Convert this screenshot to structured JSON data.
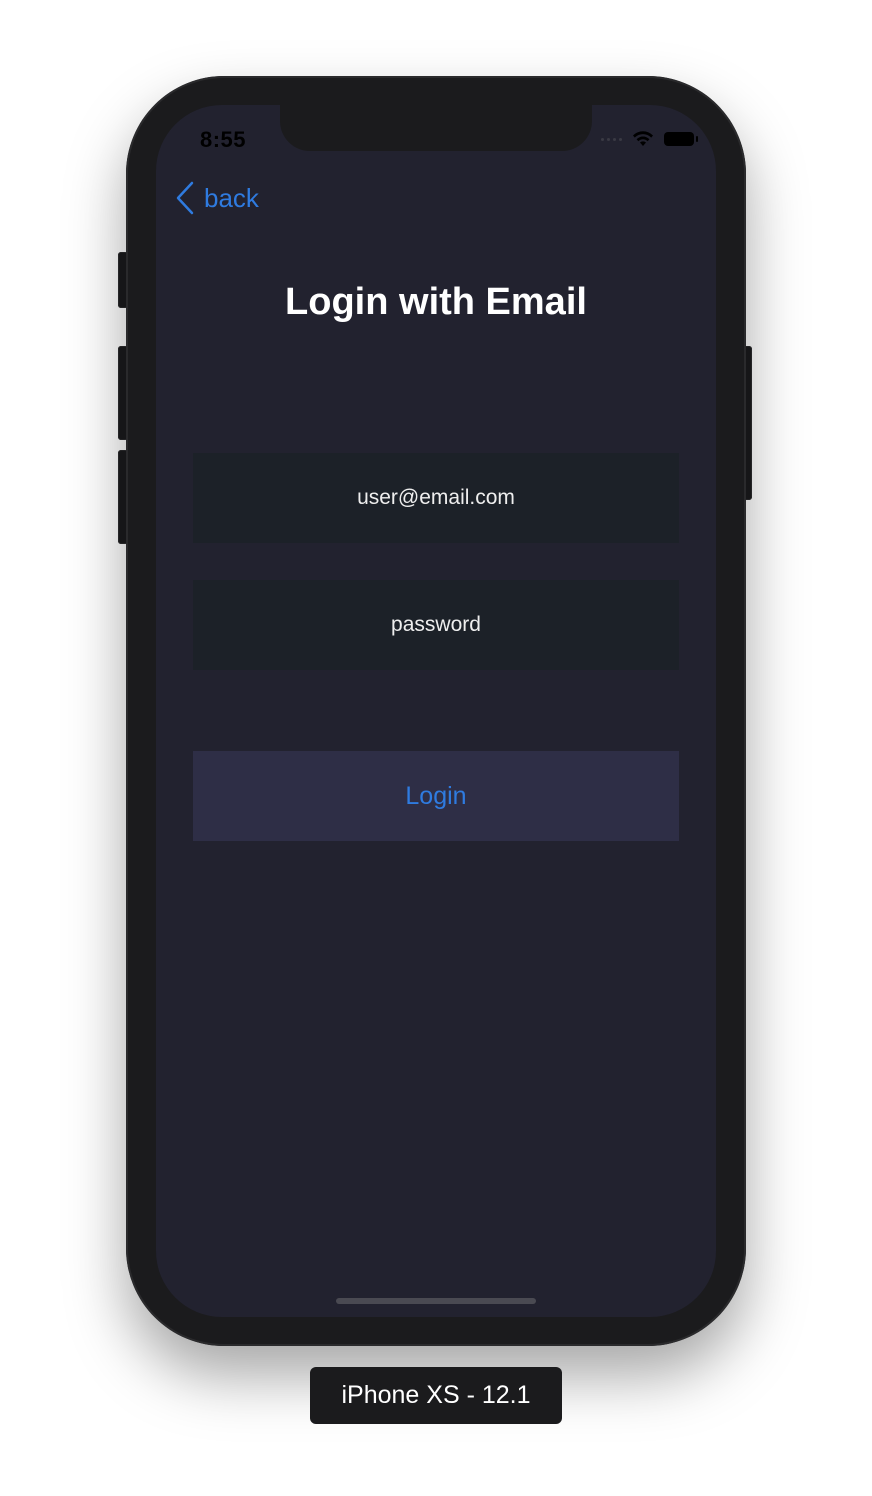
{
  "status_bar": {
    "time": "8:55"
  },
  "nav": {
    "back_label": "back"
  },
  "main": {
    "title": "Login with Email",
    "email_field": {
      "value": "user@email.com",
      "placeholder": "user@email.com"
    },
    "password_field": {
      "value": "password",
      "placeholder": "password"
    },
    "login_label": "Login"
  },
  "device": {
    "label": "iPhone XS - 12.1"
  },
  "colors": {
    "background": "#22222f",
    "accent": "#2f7be0",
    "field_bg": "#1c2128",
    "button_bg": "#2e2e46"
  },
  "icons": {
    "back": "chevron-left-icon",
    "wifi": "wifi-icon",
    "battery": "battery-icon",
    "signal": "cellular-signal-icon"
  }
}
